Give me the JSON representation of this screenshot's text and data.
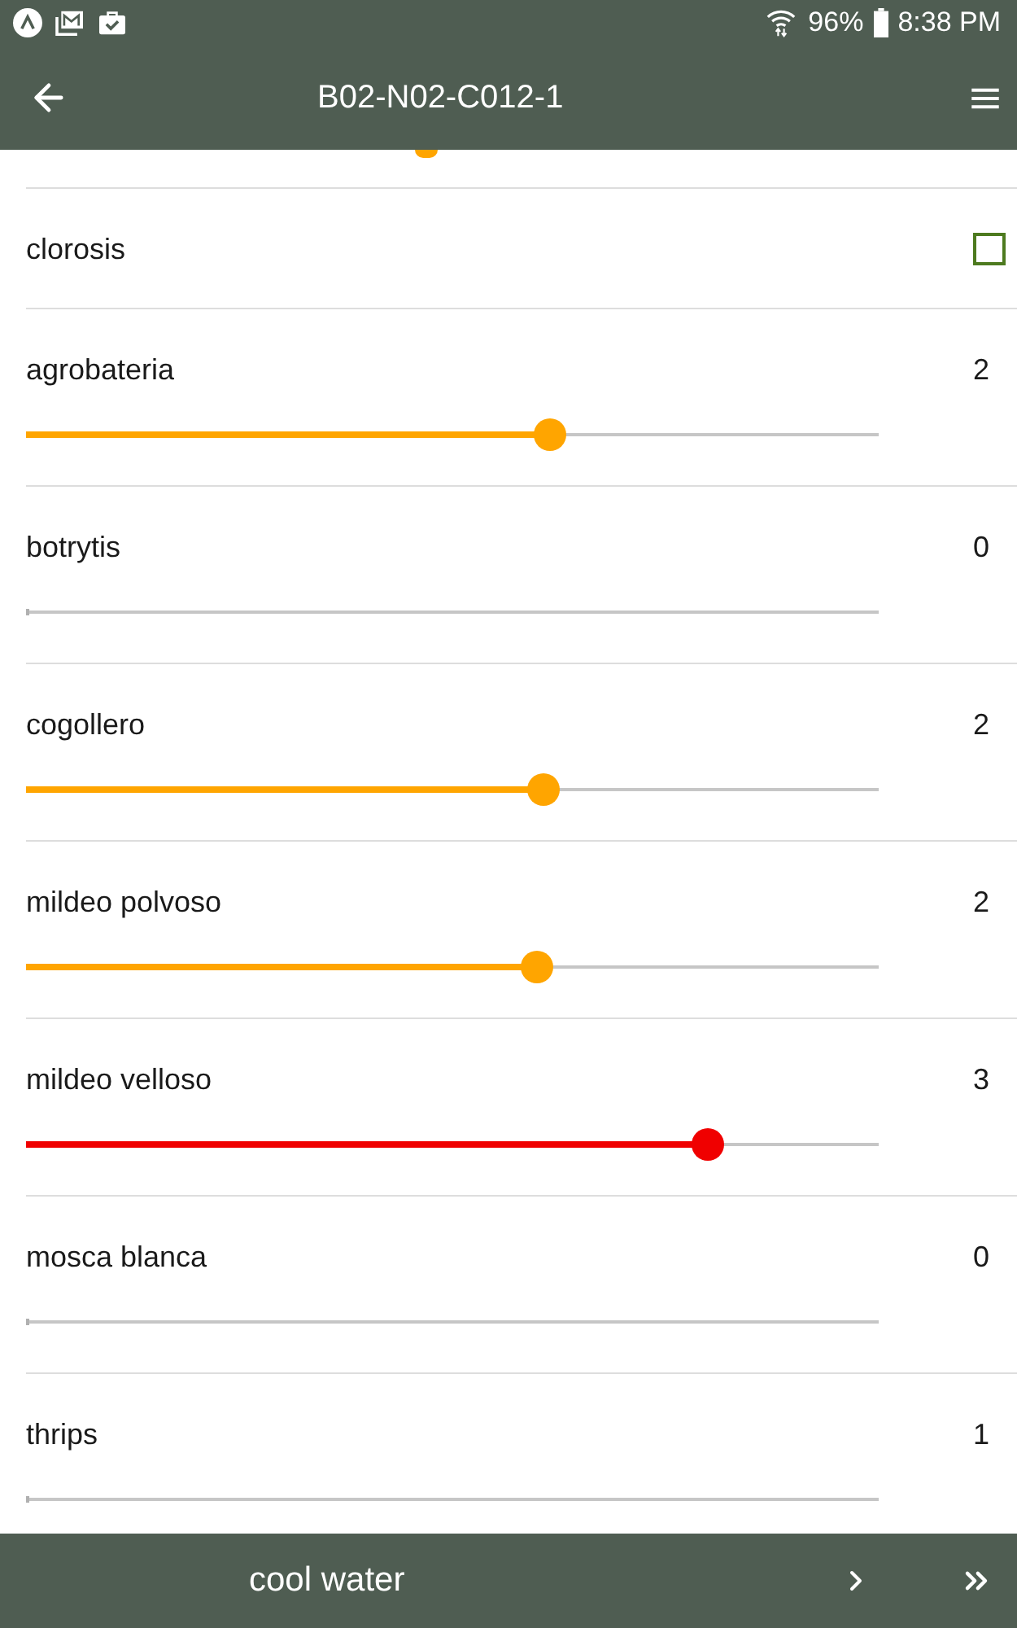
{
  "status_bar": {
    "battery": "96%",
    "time": "8:38 PM"
  },
  "toolbar": {
    "title": "B02-N02-C012-1"
  },
  "scrolled_item": {
    "level": 0.47,
    "color": "#ffa500"
  },
  "items": [
    {
      "kind": "checkbox",
      "label": "clorosis",
      "checked": false
    },
    {
      "kind": "slider",
      "label": "agrobateria",
      "value": "2",
      "level": 0.614,
      "color": "#ffa500"
    },
    {
      "kind": "slider",
      "label": "botrytis",
      "value": "0",
      "level": 0
    },
    {
      "kind": "slider",
      "label": "cogollero",
      "value": "2",
      "level": 0.607,
      "color": "#ffa500"
    },
    {
      "kind": "slider",
      "label": "mildeo polvoso",
      "value": "2",
      "level": 0.599,
      "color": "#ffa500"
    },
    {
      "kind": "slider",
      "label": "mildeo velloso",
      "value": "3",
      "level": 0.8,
      "color": "#f00000"
    },
    {
      "kind": "slider",
      "label": "mosca blanca",
      "value": "0",
      "level": 0
    },
    {
      "kind": "slider",
      "label": "thrips",
      "value": "1",
      "level": 0
    }
  ],
  "bottom_bar": {
    "label": "cool water"
  }
}
